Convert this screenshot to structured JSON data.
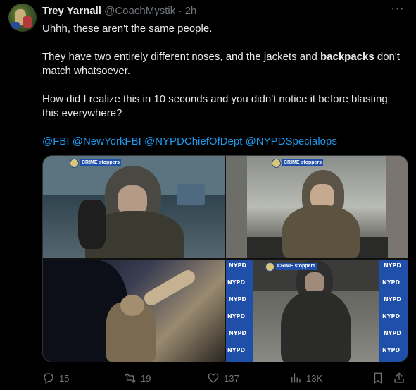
{
  "tweet": {
    "author_name": "Trey Yarnall",
    "handle": "@CoachMystik",
    "separator": "·",
    "time": "2h",
    "more_label": "···",
    "paragraphs": [
      "Uhhh, these aren't the same people.",
      "They have two entirely different noses, and the jackets and",
      "backpacks",
      "don't match whatsoever.",
      "How did I realize this in 10 seconds and you didn't notice it before blasting this everywhere?"
    ],
    "mentions": [
      "@FBI",
      "@NewYorkFBI",
      "@NYPDChiefOfDept",
      "@NYPDSpecialops"
    ]
  },
  "media": {
    "badge_label": "CRIME stoppers",
    "nypd_label": "NYPD"
  },
  "actions": {
    "replies": "15",
    "reposts": "19",
    "likes": "137",
    "views": "13K"
  },
  "colors": {
    "background": "#000000",
    "text": "#e7e9ea",
    "muted": "#71767b",
    "link": "#1d9bf0"
  }
}
